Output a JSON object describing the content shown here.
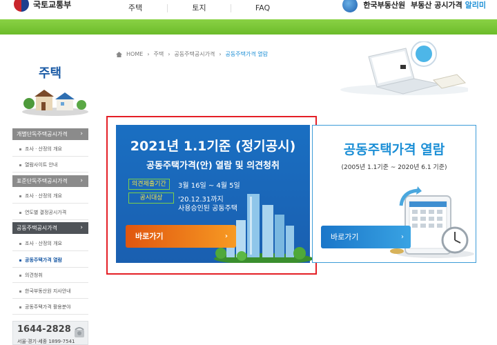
{
  "header": {
    "ministry": "국토교통부",
    "nav": [
      "주택",
      "토지",
      "FAQ"
    ],
    "agency": "한국부동산원",
    "service_prefix": "부동산 공시가격",
    "service_highlight": "알리미"
  },
  "sidebar": {
    "title": "주택",
    "sections": [
      {
        "label": "개별단독주택공시가격",
        "items": [
          "조사 · 산정의 개요",
          "열람사이트 안내"
        ]
      },
      {
        "label": "표준단독주택공시가격",
        "items": [
          "조사 · 산정의 개요",
          "연도별 결정공시가격"
        ]
      },
      {
        "label": "공동주택공시가격",
        "items": [
          "조사 · 산정의 개요",
          "공동주택가격 열람",
          "의견청취",
          "한국부동산원 지사안내",
          "공동주택가격 활용분야"
        ]
      }
    ],
    "active_item": "공동주택가격 열람",
    "phone": "1644-2828",
    "phone_sub": "서울·경기·세종 1899-7541"
  },
  "breadcrumb": [
    "HOME",
    "주택",
    "공동주택공시가격",
    "공동주택가격 열람"
  ],
  "notice_card": {
    "title1": "2021년 1.1기준 (정기공시)",
    "title2": "공동주택가격(안) 열람 및 의견청취",
    "tag1": "의견제출기간",
    "tag1_value": "3월 16일 ~ 4월 5일",
    "tag2": "공시대상",
    "tag2_value_line1": "'20.12.31까지",
    "tag2_value_line2": "사용승인된 공동주택",
    "button": "바로가기"
  },
  "view_card": {
    "title": "공동주택가격 열람",
    "subtitle": "(2005년 1.1기준 ~ 2020년 6.1 기준)",
    "button": "바로가기"
  },
  "colors": {
    "green_bar": "#6cbb2a",
    "primary_blue": "#1a6fc2",
    "accent_blue": "#1c8fd6",
    "orange": "#f07a1a",
    "highlight_red": "#e41e25"
  }
}
